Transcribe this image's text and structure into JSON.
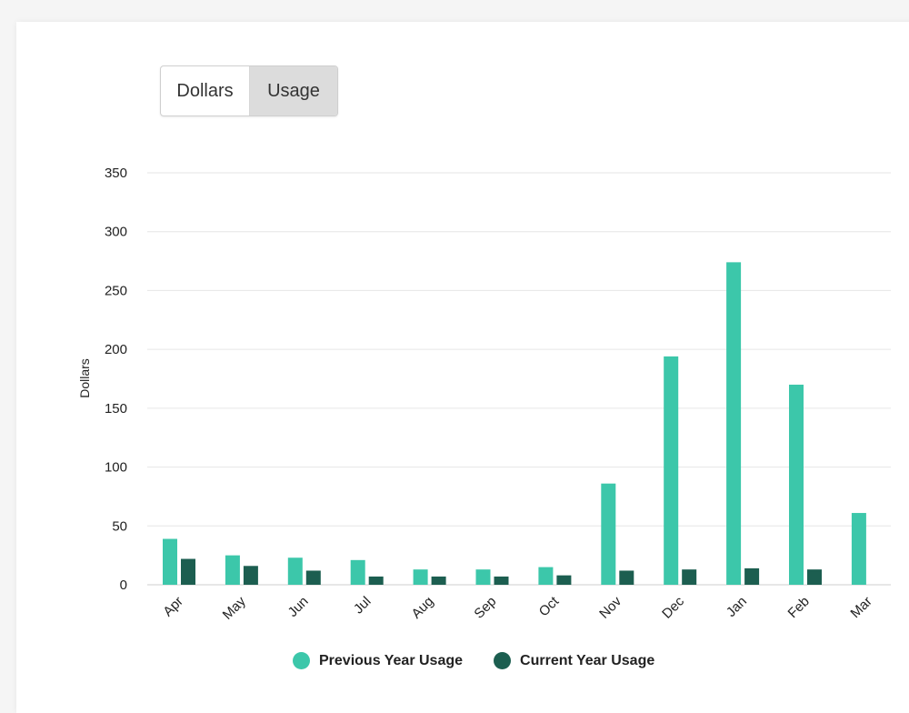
{
  "toggle": {
    "dollars_label": "Dollars",
    "usage_label": "Usage",
    "selected": "Usage"
  },
  "colors": {
    "previous": "#3cc7aa",
    "current": "#1c5e50",
    "grid": "#e6e6e6"
  },
  "chart_data": {
    "type": "bar",
    "ylabel": "Dollars",
    "xlabel": "",
    "ylim": [
      0,
      350
    ],
    "yticks": [
      0,
      50,
      100,
      150,
      200,
      250,
      300,
      350
    ],
    "grid": true,
    "legend_position": "bottom",
    "categories": [
      "Apr",
      "May",
      "Jun",
      "Jul",
      "Aug",
      "Sep",
      "Oct",
      "Nov",
      "Dec",
      "Jan",
      "Feb",
      "Mar"
    ],
    "series": [
      {
        "name": "Previous Year Usage",
        "values": [
          39,
          25,
          23,
          21,
          13,
          13,
          15,
          86,
          194,
          274,
          170,
          61
        ]
      },
      {
        "name": "Current Year Usage",
        "values": [
          22,
          16,
          12,
          7,
          7,
          7,
          8,
          12,
          13,
          14,
          13,
          null
        ]
      }
    ]
  }
}
